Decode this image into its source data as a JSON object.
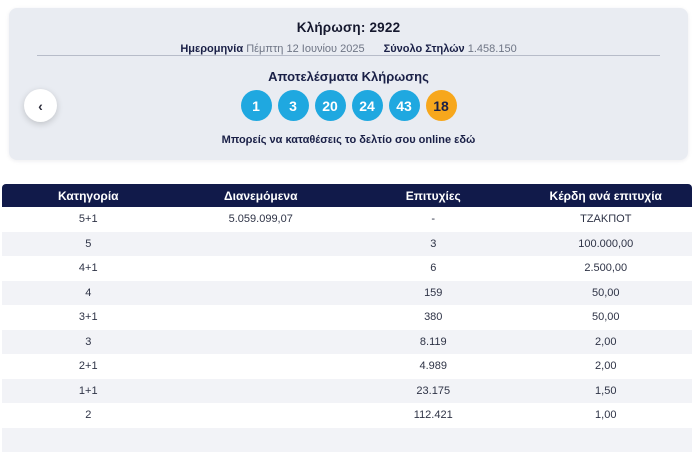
{
  "header": {
    "draw_title": "Κλήρωση: 2922",
    "date_label": "Ημερομηνία",
    "date_value": "Πέμπτη 12 Ιουνίου 2025",
    "columns_label": "Σύνολο Στηλών",
    "columns_value": "1.458.150"
  },
  "results": {
    "title": "Αποτελέσματα Κλήρωσης",
    "numbers": [
      "1",
      "3",
      "20",
      "24",
      "43"
    ],
    "bonus_number": "18",
    "online_text": "Μπορείς να καταθέσεις το δελτίο σου online εδώ",
    "prev_button_icon": "‹"
  },
  "table": {
    "headers": [
      "Κατηγορία",
      "Διανεμόμενα",
      "Επιτυχίες",
      "Κέρδη ανά επιτυχία"
    ],
    "rows": [
      [
        "5+1",
        "5.059.099,07",
        "-",
        "ΤΖΑΚΠΟΤ"
      ],
      [
        "5",
        "",
        "3",
        "100.000,00"
      ],
      [
        "4+1",
        "",
        "6",
        "2.500,00"
      ],
      [
        "4",
        "",
        "159",
        "50,00"
      ],
      [
        "3+1",
        "",
        "380",
        "50,00"
      ],
      [
        "3",
        "",
        "8.119",
        "2,00"
      ],
      [
        "2+1",
        "",
        "4.989",
        "2,00"
      ],
      [
        "1+1",
        "",
        "23.175",
        "1,50"
      ],
      [
        "2",
        "",
        "112.421",
        "1,00"
      ],
      [
        "",
        "",
        "",
        ""
      ]
    ]
  },
  "colors": {
    "accent_blue": "#1fa8e0",
    "accent_orange": "#f7a71c",
    "navy": "#111a4a",
    "card_background": "#e9ecf2"
  }
}
